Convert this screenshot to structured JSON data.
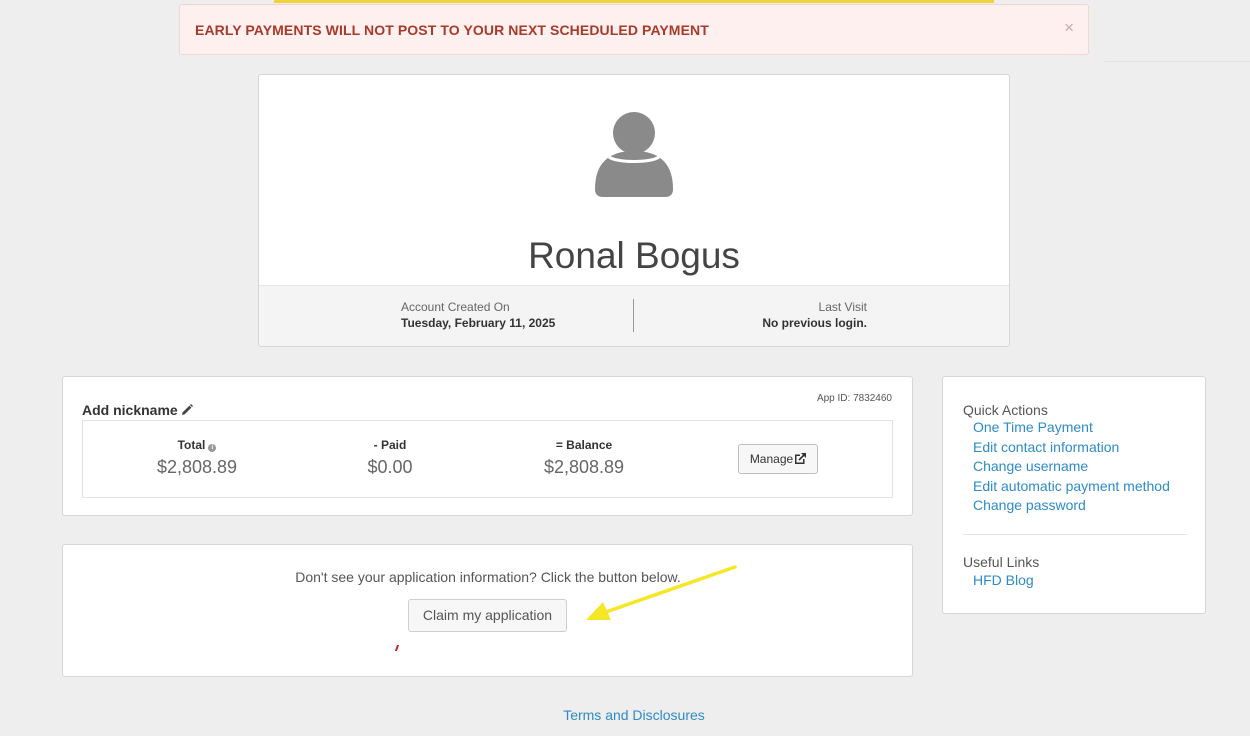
{
  "alert": {
    "message": "EARLY PAYMENTS WILL NOT POST TO YOUR NEXT SCHEDULED PAYMENT",
    "close_glyph": "×",
    "color": "#a83a2c"
  },
  "profile": {
    "name": "Ronal Bogus",
    "avatar_icon": "user-silhouette-icon",
    "account_created_label": "Account Created On",
    "account_created_value": "Tuesday, February 11, 2025",
    "last_visit_label": "Last Visit",
    "last_visit_value": "No previous login."
  },
  "account": {
    "nickname_label": "Add nickname",
    "app_id": "App ID: 7832460",
    "total_label": "Total",
    "total_value": "$2,808.89",
    "paid_label": "- Paid",
    "paid_value": "$0.00",
    "balance_label": "= Balance",
    "balance_value": "$2,808.89",
    "manage_label": "Manage"
  },
  "claim": {
    "text": "Don't see your application information? Click the button below.",
    "button_label": "Claim my application"
  },
  "quick_actions": {
    "title": "Quick Actions",
    "items": [
      {
        "label": "One Time Payment"
      },
      {
        "label": "Edit contact information"
      },
      {
        "label": "Change username"
      },
      {
        "label": "Edit automatic payment method"
      },
      {
        "label": "Change password"
      }
    ]
  },
  "useful_links": {
    "title": "Useful Links",
    "items": [
      {
        "label": "HFD Blog"
      }
    ]
  },
  "footer": {
    "terms_label": "Terms and Disclosures"
  },
  "colors": {
    "link": "#2e8bc9",
    "annotation_arrow": "#f5e626",
    "top_strip": "#f2d23c"
  }
}
